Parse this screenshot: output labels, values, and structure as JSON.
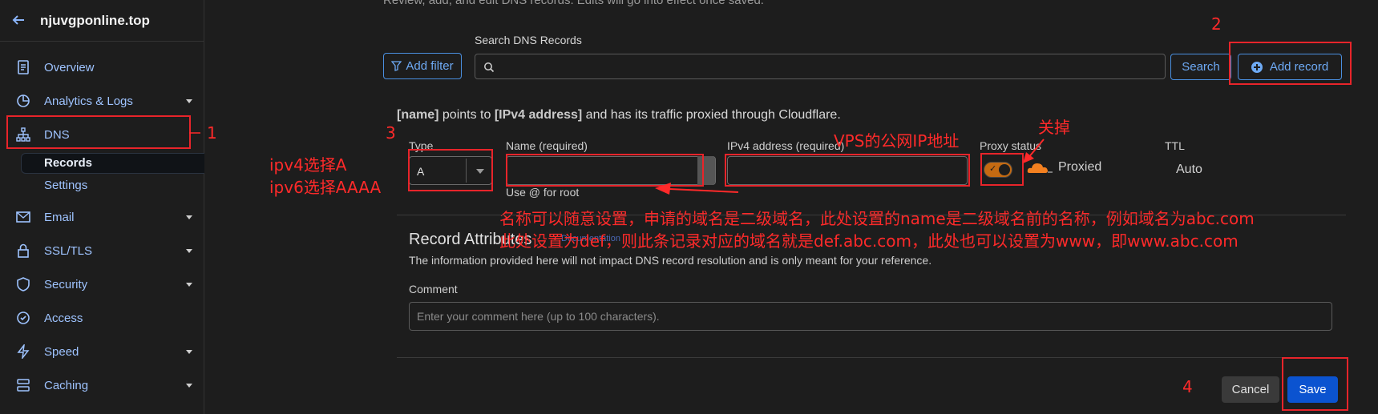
{
  "sidebar": {
    "domain": "njuvgponline.top",
    "items": [
      {
        "label": "Overview"
      },
      {
        "label": "Analytics & Logs"
      },
      {
        "label": "DNS"
      },
      {
        "label": "Email"
      },
      {
        "label": "SSL/TLS"
      },
      {
        "label": "Security"
      },
      {
        "label": "Access"
      },
      {
        "label": "Speed"
      },
      {
        "label": "Caching"
      }
    ],
    "sub_items": [
      {
        "label": "Records"
      },
      {
        "label": "Settings"
      }
    ]
  },
  "main": {
    "top_text": "Review, add, and edit DNS records. Edits will go into effect once saved.",
    "add_filter": "Add filter",
    "search_label": "Search DNS Records",
    "search_button": "Search",
    "add_record": "Add record",
    "info_name": "[name]",
    "info_mid": " points to ",
    "info_ipv4": "[IPv4 address]",
    "info_end": " and has its traffic proxied through Cloudflare.",
    "fields": {
      "type_label": "Type",
      "type_value": "A",
      "name_label": "Name (required)",
      "ipv4_label": "IPv4 address (required)",
      "proxy_label": "Proxy status",
      "ttl_label": "TTL",
      "name_hint": "Use @ for root",
      "proxied": "Proxied",
      "ttl_value": "Auto"
    },
    "record_attributes": {
      "title": "Record Attributes",
      "subtitle": "The information provided here will not impact DNS record resolution and is only meant for your reference.",
      "comment_label": "Comment",
      "comment_placeholder": "Enter your comment here (up to 100 characters).",
      "faint_text": "Documentation"
    },
    "cancel": "Cancel",
    "save": "Save"
  },
  "annotations": {
    "n1": "1",
    "n2": "2",
    "n3": "3",
    "n4": "4",
    "ipv4": "ipv4选择A",
    "ipv6": "ipv6选择AAAA",
    "vps": "VPS的公网IP地址",
    "off": "关掉",
    "note1": "名称可以随意设置，申请的域名是二级域名，此处设置的name是二级域名前的名称，例如域名为abc.com",
    "note2": "此处设置为def，则此条记录对应的域名就是def.abc.com，此处也可以设置为www，即www.abc.com"
  },
  "colors": {
    "accent": "#6eaaf5",
    "annotation": "#ff2a2a",
    "save": "#0b53d0",
    "proxy": "#f38020"
  }
}
